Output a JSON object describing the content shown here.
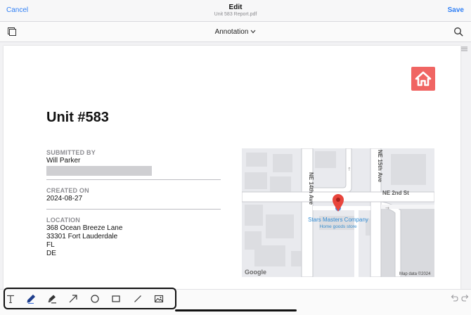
{
  "header": {
    "cancel_label": "Cancel",
    "title": "Edit",
    "subtitle": "Unit 583 Report.pdf",
    "save_label": "Save"
  },
  "toolbar": {
    "mode_label": "Annotation",
    "icons": [
      "pages-icon",
      "chevron-down-icon",
      "search-icon"
    ]
  },
  "document": {
    "title": "Unit #583",
    "submitted_by": {
      "label": "SUBMITTED BY",
      "name": "Will Parker"
    },
    "created_on": {
      "label": "CREATED ON",
      "date": "2024-08-27"
    },
    "location": {
      "label": "LOCATION",
      "street": "368 Ocean Breeze Lane",
      "city_line": "33301 Fort Lauderdale",
      "state": "FL",
      "country": "DE"
    },
    "logo_color": "#f06563"
  },
  "map": {
    "streets": [
      "NE 14th Ave",
      "NE 15th Ave",
      "NE 2nd St"
    ],
    "place_name": "Stars Masters Company",
    "place_category": "Home goods store",
    "attribution": "Map data ©2024",
    "provider": "Google",
    "pin_color": "#e8453c"
  },
  "annotation_tools": [
    "text-tool-icon",
    "pen-tool-icon",
    "highlighter-tool-icon",
    "arrow-tool-icon",
    "circle-tool-icon",
    "rectangle-tool-icon",
    "line-tool-icon",
    "image-tool-icon"
  ],
  "colors": {
    "accent": "#2f7ff5",
    "label_gray": "#8d8d92"
  }
}
